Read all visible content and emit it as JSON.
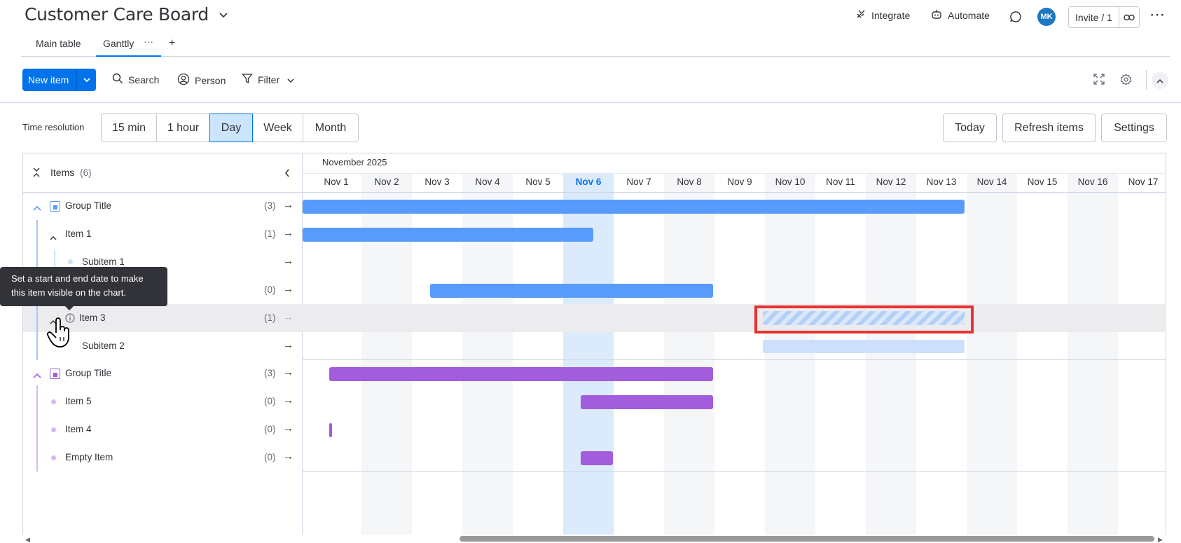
{
  "board": {
    "title": "Customer Care Board"
  },
  "header": {
    "integrate": "Integrate",
    "automate": "Automate",
    "avatar_initials": "MK",
    "invite": "Invite / 1"
  },
  "tabs": [
    {
      "label": "Main table"
    },
    {
      "label": "Ganttly"
    }
  ],
  "toolbar": {
    "new_item": "New item",
    "search": "Search",
    "person": "Person",
    "filter": "Filter"
  },
  "time_resolution": {
    "label": "Time resolution",
    "options": [
      "15 min",
      "1 hour",
      "Day",
      "Week",
      "Month"
    ],
    "selected": "Day"
  },
  "actions": {
    "today": "Today",
    "refresh": "Refresh items",
    "settings": "Settings"
  },
  "items_header": {
    "label": "Items",
    "count": "(6)"
  },
  "month_label": "November 2025",
  "days": [
    "Nov 1",
    "Nov 2",
    "Nov 3",
    "Nov 4",
    "Nov 5",
    "Nov 6",
    "Nov 7",
    "Nov 8",
    "Nov 9",
    "Nov 10",
    "Nov 11",
    "Nov 12",
    "Nov 13",
    "Nov 14",
    "Nov 15",
    "Nov 16",
    "Nov 17"
  ],
  "today_label": "Nov 6",
  "rows": [
    {
      "label": "Group Title",
      "count": "(3)",
      "arrow": "→"
    },
    {
      "label": "Item 1",
      "count": "(1)",
      "arrow": "→"
    },
    {
      "label": "Subitem 1",
      "count": "",
      "arrow": "→"
    },
    {
      "label": "",
      "count": "(0)",
      "arrow": "→"
    },
    {
      "label": "Item 3",
      "count": "(1)",
      "arrow": "→"
    },
    {
      "label": "Subitem 2",
      "count": "",
      "arrow": "→"
    },
    {
      "label": "Group Title",
      "count": "(3)",
      "arrow": "→"
    },
    {
      "label": "Item 5",
      "count": "(0)",
      "arrow": "→"
    },
    {
      "label": "Item 4",
      "count": "(0)",
      "arrow": "→"
    },
    {
      "label": "Empty Item",
      "count": "(0)",
      "arrow": "→"
    }
  ],
  "tooltip": {
    "line1": "Set a start and end date to make",
    "line2": "this item visible on the chart."
  },
  "colors": {
    "blue_group": "#579bfc",
    "purple_group": "#a25ddc",
    "accent": "#0073ea",
    "highlight": "#e8322f"
  }
}
